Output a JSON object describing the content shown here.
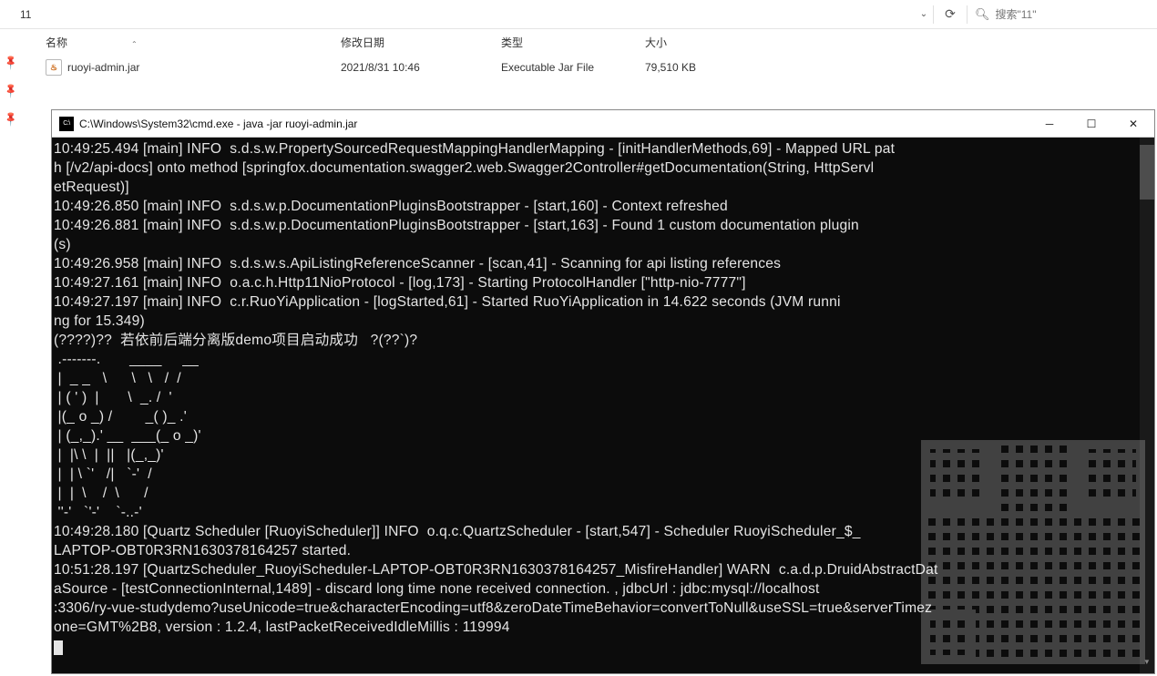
{
  "addressbar": {
    "path": "11",
    "search_placeholder": "搜索\"11\""
  },
  "columns": {
    "name": "名称",
    "date": "修改日期",
    "type": "类型",
    "size": "大小"
  },
  "file": {
    "name": "ruoyi-admin.jar",
    "date": "2021/8/31 10:46",
    "type": "Executable Jar File",
    "size": "79,510 KB"
  },
  "cmd": {
    "title": "C:\\Windows\\System32\\cmd.exe - java  -jar ruoyi-admin.jar",
    "lines": [
      "10:49:25.494 [main] INFO  s.d.s.w.PropertySourcedRequestMappingHandlerMapping - [initHandlerMethods,69] - Mapped URL pat",
      "h [/v2/api-docs] onto method [springfox.documentation.swagger2.web.Swagger2Controller#getDocumentation(String, HttpServl",
      "etRequest)]",
      "10:49:26.850 [main] INFO  s.d.s.w.p.DocumentationPluginsBootstrapper - [start,160] - Context refreshed",
      "10:49:26.881 [main] INFO  s.d.s.w.p.DocumentationPluginsBootstrapper - [start,163] - Found 1 custom documentation plugin",
      "(s)",
      "10:49:26.958 [main] INFO  s.d.s.w.s.ApiListingReferenceScanner - [scan,41] - Scanning for api listing references",
      "10:49:27.161 [main] INFO  o.a.c.h.Http11NioProtocol - [log,173] - Starting ProtocolHandler [\"http-nio-7777\"]",
      "10:49:27.197 [main] INFO  c.r.RuoYiApplication - [logStarted,61] - Started RuoYiApplication in 14.622 seconds (JVM runni",
      "ng for 15.349)",
      "(????)??  若依前后端分离版demo项目启动成功   ?(??`)?",
      " .-------.       ____     __        ",
      " |  _ _   \\      \\   \\   /  /    ",
      " | ( ' )  |       \\  _. /  '       ",
      " |(_ o _) /        _( )_ .'         ",
      " | (_,_).' __  ___(_ o _)'          ",
      " |  |\\ \\  |  ||   |(_,_)'         ",
      " |  | \\ `'   /|   `-'  /           ",
      " |  |  \\    /  \\      /           ",
      " ''-'   `'-'    `-..-'              ",
      "10:49:28.180 [Quartz Scheduler [RuoyiScheduler]] INFO  o.q.c.QuartzScheduler - [start,547] - Scheduler RuoyiScheduler_$_",
      "LAPTOP-OBT0R3RN1630378164257 started.",
      "10:51:28.197 [QuartzScheduler_RuoyiScheduler-LAPTOP-OBT0R3RN1630378164257_MisfireHandler] WARN  c.a.d.p.DruidAbstractDat",
      "aSource - [testConnectionInternal,1489] - discard long time none received connection. , jdbcUrl : jdbc:mysql://localhost",
      ":3306/ry-vue-studydemo?useUnicode=true&characterEncoding=utf8&zeroDateTimeBehavior=convertToNull&useSSL=true&serverTimez",
      "one=GMT%2B8, version : 1.2.4, lastPacketReceivedIdleMillis : 119994"
    ]
  }
}
